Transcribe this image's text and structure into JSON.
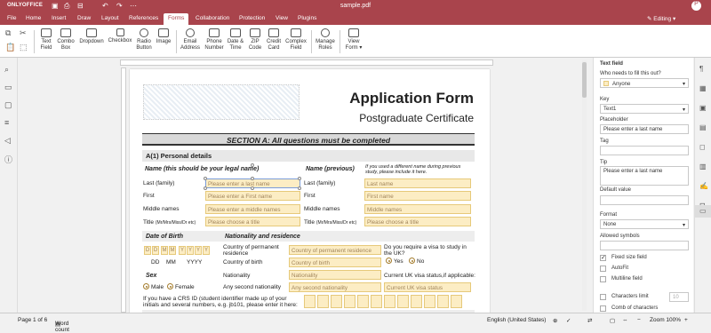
{
  "app": {
    "brand": "ONLYOFFICE",
    "doc_title": "sample.pdf",
    "mode": "Editing"
  },
  "tabs": [
    "File",
    "Home",
    "Insert",
    "Draw",
    "Layout",
    "References",
    "Forms",
    "Collaboration",
    "Protection",
    "View",
    "Plugins"
  ],
  "active_tab": "Forms",
  "toolbar": [
    {
      "l1": "Text",
      "l2": "Field",
      "icon": "text-field-icon"
    },
    {
      "l1": "Combo",
      "l2": "Box",
      "icon": "combo-box-icon"
    },
    {
      "l1": "Dropdown",
      "l2": "",
      "icon": "dropdown-icon"
    },
    {
      "l1": "Checkbox",
      "l2": "",
      "icon": "checkbox-icon"
    },
    {
      "l1": "Radio",
      "l2": "Button",
      "icon": "radio-button-icon"
    },
    {
      "l1": "Image",
      "l2": "",
      "icon": "image-icon"
    },
    {
      "l1": "Email",
      "l2": "Address",
      "icon": "email-icon"
    },
    {
      "l1": "Phone",
      "l2": "Number",
      "icon": "phone-icon"
    },
    {
      "l1": "Date &",
      "l2": "Time",
      "icon": "date-time-icon"
    },
    {
      "l1": "ZIP",
      "l2": "Code",
      "icon": "zip-code-icon"
    },
    {
      "l1": "Credit",
      "l2": "Card",
      "icon": "credit-card-icon"
    },
    {
      "l1": "Complex",
      "l2": "Field",
      "icon": "complex-field-icon"
    },
    {
      "l1": "Manage",
      "l2": "Roles",
      "icon": "manage-roles-icon"
    },
    {
      "l1": "View",
      "l2": "Form",
      "icon": "view-form-icon"
    }
  ],
  "document": {
    "title": "Application Form",
    "subtitle": "Postgraduate Certificate",
    "section_a": "SECTION A: All questions must be completed",
    "a1": "A(1) Personal details",
    "name_legal": "Name (this should be your legal name)",
    "name_prev": "Name (previous)",
    "name_prev_note": "If you used a different name during previous study, please include it here.",
    "rows": [
      {
        "label": "Last (family)",
        "placeholder": "Please enter a last name",
        "prev": "Last name"
      },
      {
        "label": "First",
        "placeholder": "Please enter a First name",
        "prev": "First name"
      },
      {
        "label": "Middle names",
        "placeholder": "Please enter a middle names",
        "prev": "Middle names"
      },
      {
        "label": "Title",
        "label_small": "(Mr/Mrs/Miss/Dr etc)",
        "placeholder": "Please choose a title",
        "prev": "Please choose a title"
      }
    ],
    "dob": "Date of Birth",
    "nationality_hdr": "Nationality and residence",
    "dob_cells": [
      "D",
      "D",
      "M",
      "M",
      "Y",
      "Y",
      "Y",
      "Y"
    ],
    "dob_fmt": [
      "DD",
      "MM",
      "YYYY"
    ],
    "country_perm": "Country of permanent residence",
    "country_perm_ph": "Country of permanent residence",
    "country_birth": "Country of birth",
    "country_birth_ph": "Country of birth",
    "nationality": "Nationality",
    "nationality_ph": "Nationality",
    "any_second": "Any second nationality",
    "any_second_ph": "Any second nationality",
    "visa_q": "Do you require a visa to study in the UK?",
    "yes": "Yes",
    "no": "No",
    "visa_status": "Current UK visa status,if applicable:",
    "visa_status_ph": "Current UK visa status",
    "sex": "Sex",
    "male": "Male",
    "female": "Female",
    "crs": "If you have a CRS ID (student identifier made up of your initials and several numbers, e.g. jb101, please enter it here:"
  },
  "panel": {
    "title": "Text field",
    "who_label": "Who needs to fill this out?",
    "who_value": "Anyone",
    "key_label": "Key",
    "key_value": "Text1",
    "placeholder_label": "Placeholder",
    "placeholder_value": "Please enter a last name",
    "tag_label": "Tag",
    "tip_label": "Tip",
    "tip_value": "Please enter a last name",
    "default_label": "Default value",
    "format_label": "Format",
    "format_value": "None",
    "allowed_label": "Allowed symbols",
    "fixed_size": "Fixed size field",
    "autofit": "AutoFit",
    "multiline": "Multiline field",
    "char_limit": "Characters limit",
    "char_limit_value": "10",
    "comb": "Comb of characters"
  },
  "status": {
    "page": "Page 1 of 6",
    "word_count": "Word count",
    "language": "English (United States)",
    "zoom": "Zoom 100%"
  }
}
